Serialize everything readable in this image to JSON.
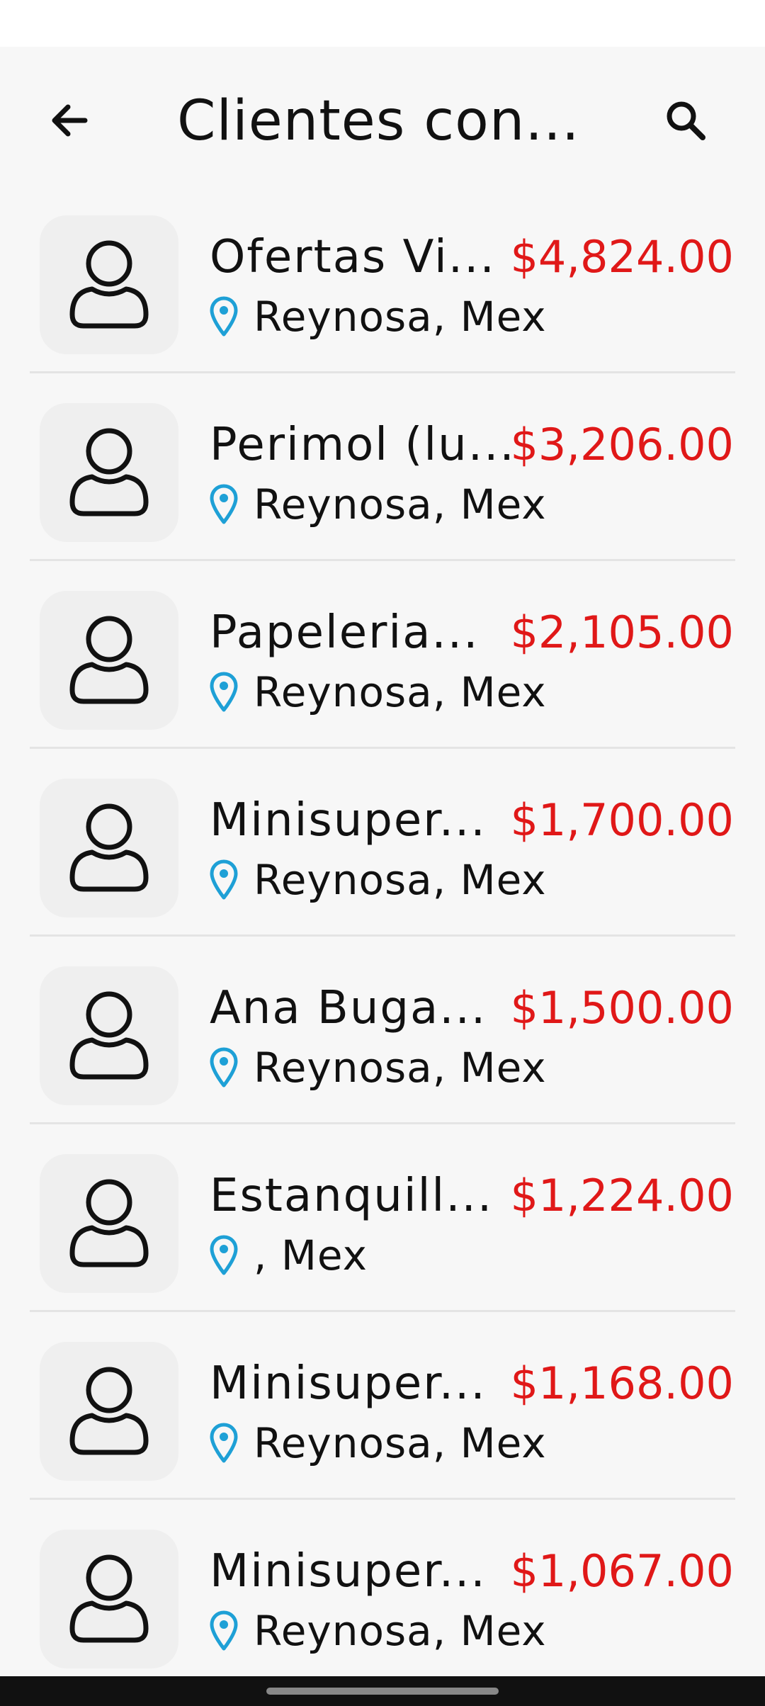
{
  "header": {
    "title": "Clientes con..."
  },
  "icons": {
    "back": "arrow-left-icon",
    "search": "search-icon",
    "avatar": "user-icon",
    "location": "location-pin-icon"
  },
  "colors": {
    "amount": "#e01818",
    "pin": "#1ea0d6"
  },
  "clients": [
    {
      "name": "Ofertas Vi...",
      "amount": "$4,824.00",
      "location": "Reynosa, Mex"
    },
    {
      "name": "Perimol (lu...",
      "amount": "$3,206.00",
      "location": "Reynosa, Mex"
    },
    {
      "name": "Papeleria...",
      "amount": "$2,105.00",
      "location": "Reynosa, Mex"
    },
    {
      "name": "Minisuper...",
      "amount": "$1,700.00",
      "location": "Reynosa, Mex"
    },
    {
      "name": "Ana Buga...",
      "amount": "$1,500.00",
      "location": "Reynosa, Mex"
    },
    {
      "name": "Estanquill...",
      "amount": "$1,224.00",
      "location": ", Mex"
    },
    {
      "name": "Minisuper...",
      "amount": "$1,168.00",
      "location": "Reynosa, Mex"
    },
    {
      "name": "Minisuper...",
      "amount": "$1,067.00",
      "location": "Reynosa, Mex"
    }
  ]
}
